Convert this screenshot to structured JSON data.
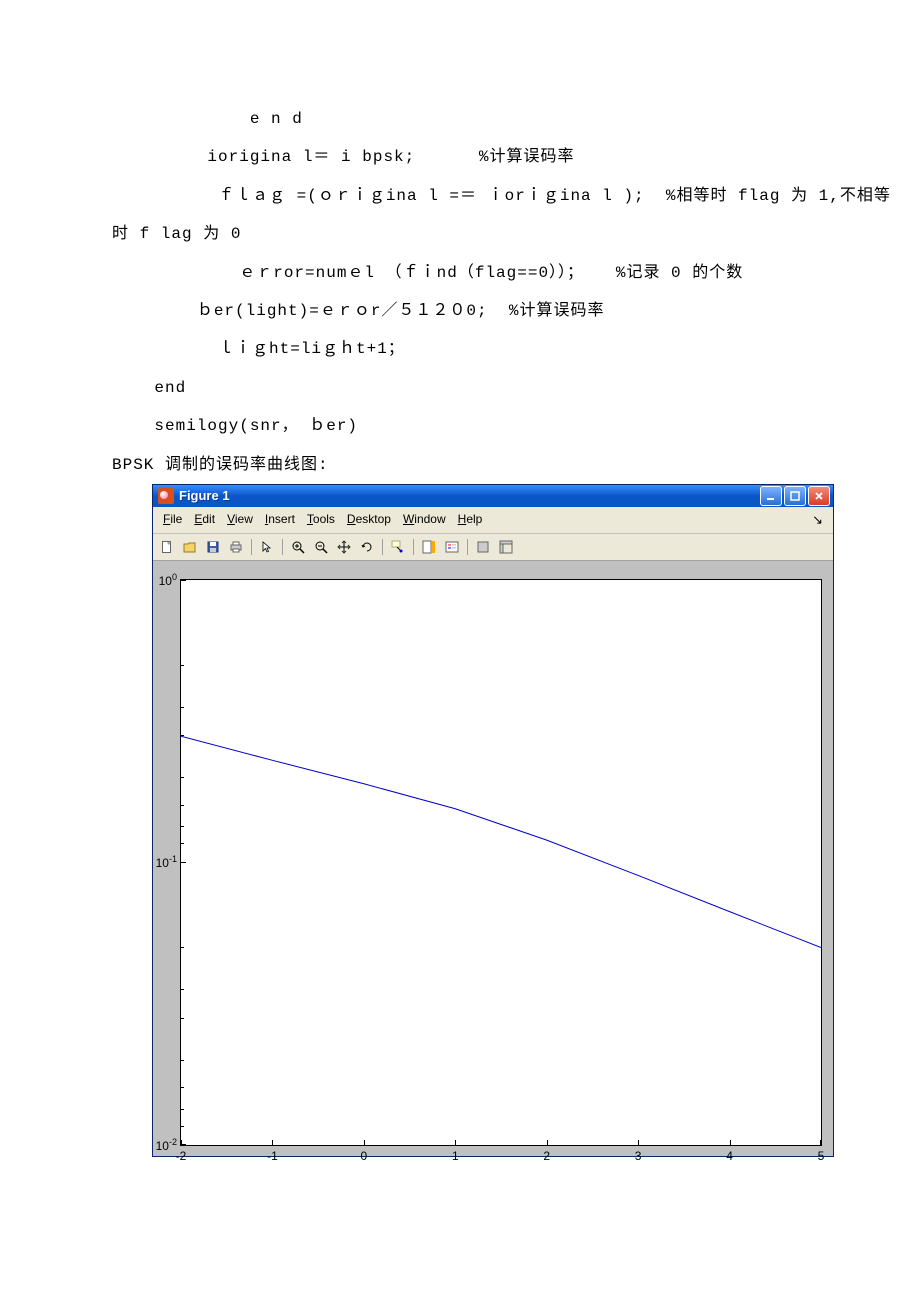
{
  "code": {
    "l1": "             e n d",
    "l2": "         iorigina l＝ i bpsk;      %计算误码率",
    "l3": "          ｆｌａｇ =(ｏｒｉｇina l =＝ ｉorｉｇina l );  %相等时 flag 为 1,不相等",
    "l4": "时 f lag 为 0",
    "l5": "            ｅｒror=numｅl （ｆｉnd（flag==0））；   %记录 0 的个数",
    "l6": "        ｂer(light)=ｅｒｏr／５１２０0;  %计算误码率",
    "l7": "          ｌｉｇht=liｇｈt+1；",
    "l8": "    end",
    "l9": "    semilogy(snr， ｂer)",
    "l10": "    BPSK 调制的误码率曲线图:"
  },
  "figure": {
    "title": "Figure 1",
    "menus": [
      "File",
      "Edit",
      "View",
      "Insert",
      "Tools",
      "Desktop",
      "Window",
      "Help"
    ],
    "toolbar_arrow": "⇘"
  },
  "chart_data": {
    "type": "line",
    "title": "",
    "xlabel": "",
    "ylabel": "",
    "xlim": [
      -2,
      5
    ],
    "ylim_log10": [
      -2,
      0
    ],
    "x": [
      -2,
      -1,
      0,
      1,
      2,
      3,
      4,
      5
    ],
    "y": [
      0.28,
      0.23,
      0.19,
      0.155,
      0.12,
      0.09,
      0.067,
      0.05
    ],
    "yscale": "log",
    "xticks": [
      -2,
      -1,
      0,
      1,
      2,
      3,
      4,
      5
    ],
    "yticks": [
      0.01,
      0.1,
      1
    ],
    "ytick_labels": [
      "10⁻²",
      "10⁻¹",
      "10⁰"
    ]
  }
}
